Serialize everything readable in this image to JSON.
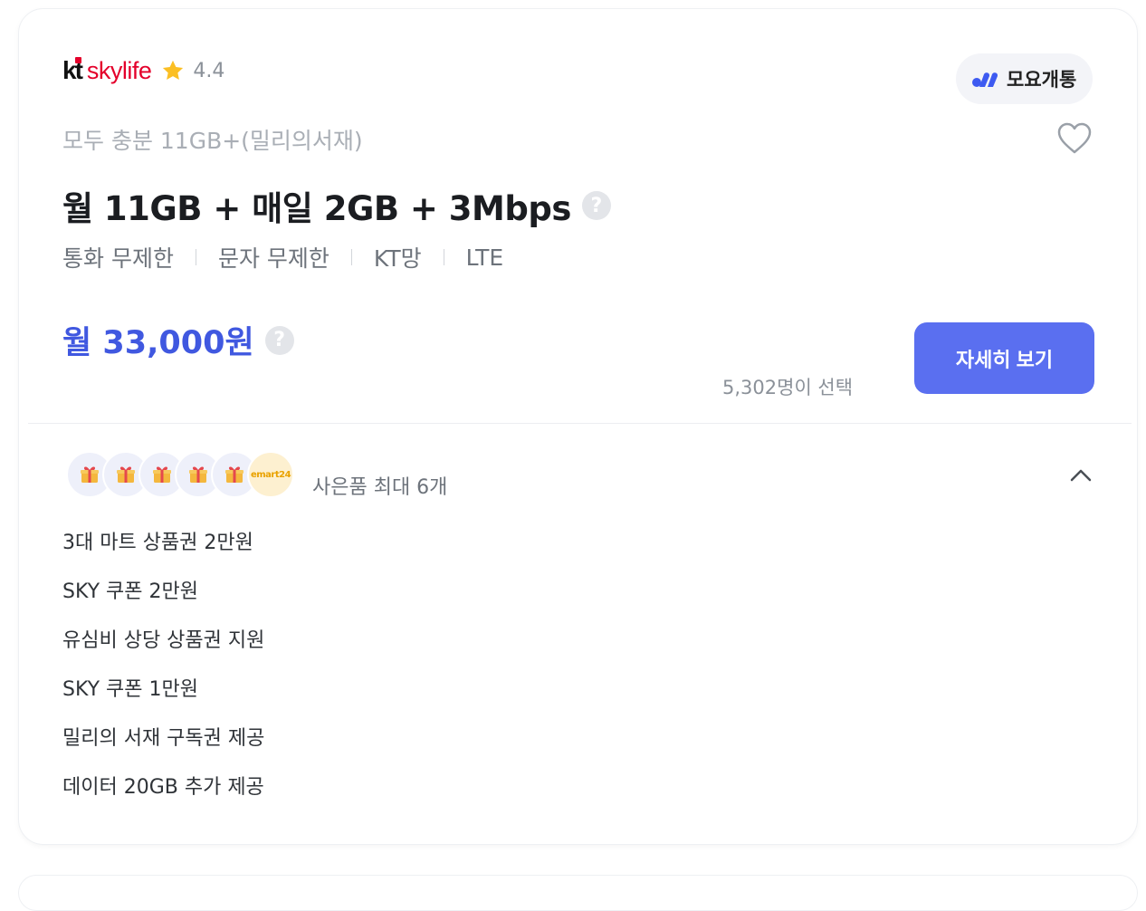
{
  "card": {
    "carrier_brand": "skylife",
    "carrier_prefix": "kt",
    "rating": "4.4",
    "mvno_badge": "모요개통",
    "plan_name": "모두 충분 11GB+(밀리의서재)",
    "headline": "월 11GB + 매일 2GB + 3Mbps",
    "specs": [
      "통화 무제한",
      "문자 무제한",
      "KT망",
      "LTE"
    ],
    "price": "월 33,000원",
    "selected_count": "5,302명이 선택",
    "detail_button": "자세히 보기",
    "gifts_summary": "사은품 최대 6개",
    "gift_partner": "emart24",
    "gifts": [
      "3대 마트 상품권 2만원",
      "SKY 쿠폰 2만원",
      "유심비 상당 상품권 지원",
      "SKY 쿠폰 1만원",
      "밀리의 서재 구독권 제공",
      "데이터 20GB 추가 제공"
    ]
  },
  "icons": {
    "rating": "star-icon",
    "favorite": "heart-icon",
    "help": "question-circle-icon",
    "gift": "gift-icon",
    "collapse": "chevron-up-icon"
  },
  "colors": {
    "accent_blue": "#4058e0",
    "button": "#5a6ff0",
    "brand_red": "#e4002b",
    "star": "#fbbf24"
  }
}
